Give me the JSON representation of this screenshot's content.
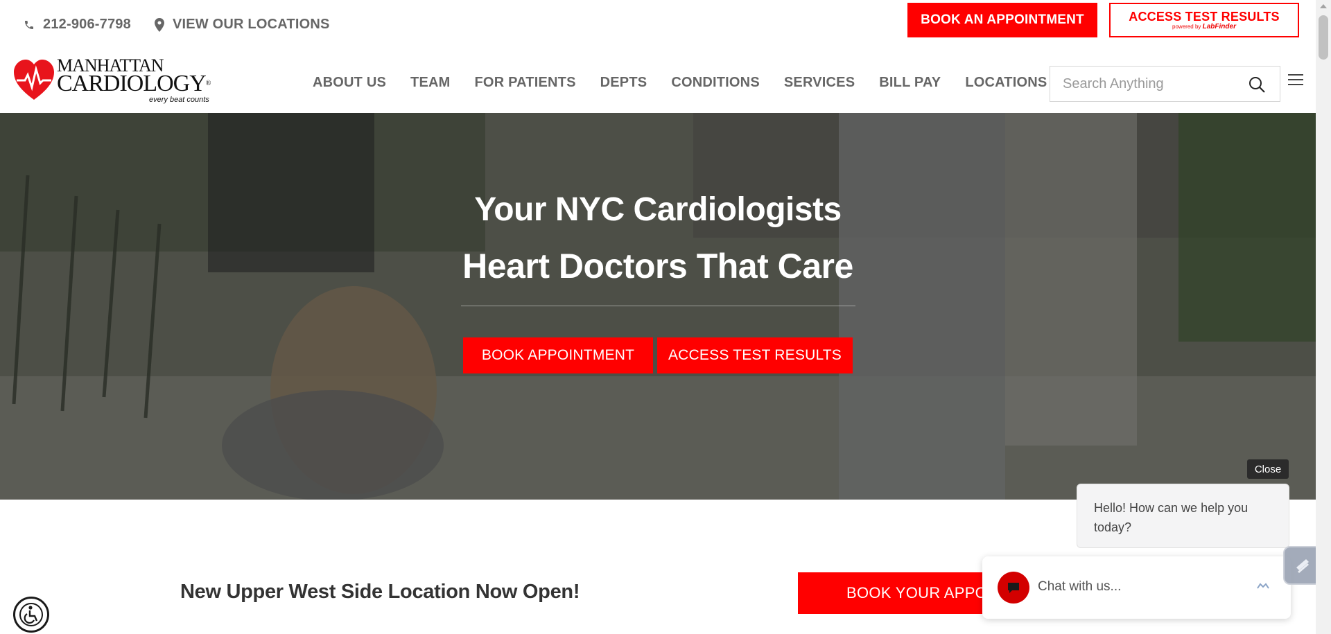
{
  "topbar": {
    "phone": "212-906-7798",
    "locations_link": "VIEW OUR LOCATIONS",
    "book_button": "BOOK AN APPOINTMENT",
    "results_button": "ACCESS TEST RESULTS",
    "results_powered_prefix": "powered by ",
    "results_powered_brand": "LabFinder"
  },
  "logo": {
    "line1": "MANHATTAN",
    "line2": "CARDIOLOGY",
    "tagline": "every beat counts",
    "brand_color": "#e8141c"
  },
  "nav": {
    "items": [
      "ABOUT US",
      "TEAM",
      "FOR PATIENTS",
      "DEPTS",
      "CONDITIONS",
      "SERVICES",
      "BILL PAY",
      "LOCATIONS"
    ],
    "search_placeholder": "Search Anything"
  },
  "hero": {
    "title_line1": "Your NYC Cardiologists",
    "title_line2": "Heart Doctors That Care",
    "btn_book": "BOOK APPOINTMENT",
    "btn_results": "ACCESS TEST RESULTS"
  },
  "promo": {
    "title": "New Upper West Side Location Now Open!",
    "button": "BOOK YOUR APPOINTMENT"
  },
  "chat": {
    "close_label": "Close",
    "greeting": "Hello! How can we help you today?",
    "input_label": "Chat with us..."
  },
  "colors": {
    "accent": "#ff0000",
    "nav_text": "#666666"
  }
}
